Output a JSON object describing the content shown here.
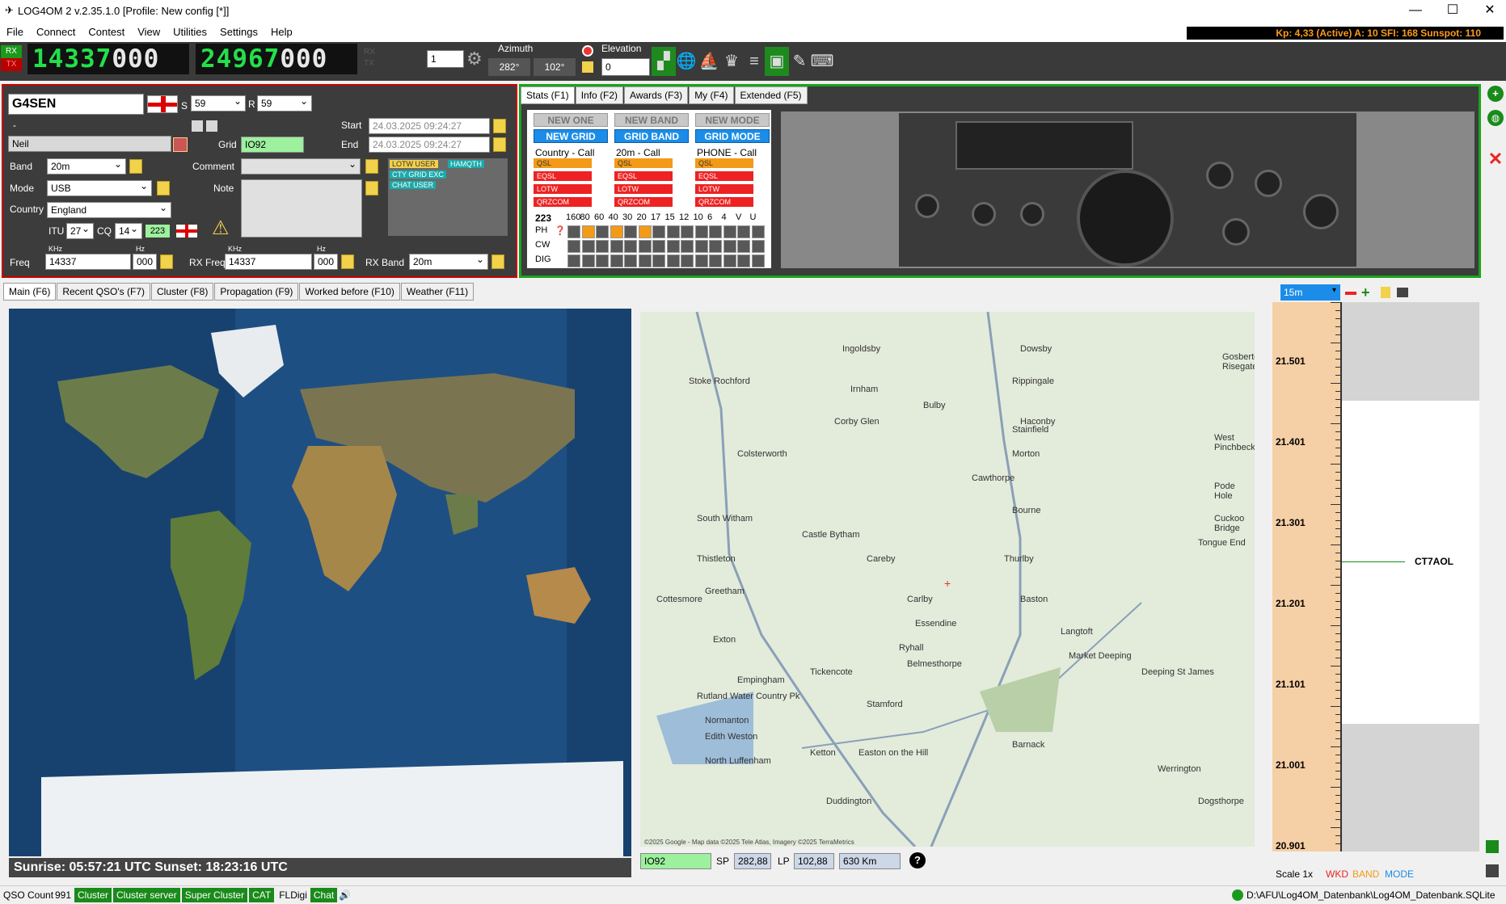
{
  "window": {
    "title": "LOG4OM 2 v.2.35.1.0 [Profile: New config [*]]"
  },
  "menu": [
    "File",
    "Connect",
    "Contest",
    "View",
    "Utilities",
    "Settings",
    "Help"
  ],
  "solar": {
    "text": "Kp: 4,33 (Active)  A: 10  SFI: 168 Sunspot: 110"
  },
  "toolbar": {
    "rx": "RX",
    "tx": "TX",
    "freq1_bright": "14337",
    "freq1_dim": "000",
    "freq2_bright": "24967",
    "freq2_dim": "000",
    "rx_small": "RX",
    "tx_small": "TX",
    "step": "1",
    "azimuth_label": "Azimuth",
    "azimuth_sp": "282°",
    "azimuth_lp": "102°",
    "elevation_label": "Elevation",
    "elevation_value": "0"
  },
  "qso": {
    "callsign": "G4SEN",
    "s_label": "S",
    "s_value": "59",
    "r_label": "R",
    "r_value": "59",
    "dash": "-",
    "name": "Neil",
    "grid_label": "Grid",
    "grid": "IO92",
    "start_label": "Start",
    "start": "24.03.2025 09:24:27",
    "end_label": "End",
    "end": "24.03.2025 09:24:27",
    "band_label": "Band",
    "band": "20m",
    "comment_label": "Comment",
    "mode_label": "Mode",
    "mode": "USB",
    "note_label": "Note",
    "country_label": "Country",
    "country": "England",
    "itu_label": "ITU",
    "itu": "27",
    "cq_label": "CQ",
    "cq": "14",
    "dxcc": "223",
    "freq_label": "Freq",
    "khz_label": "KHz",
    "hz_label": "Hz",
    "freq_khz": "14337",
    "freq_hz": "000",
    "rxfreq_label": "RX Freq",
    "rx_khz": "14337",
    "rx_hz": "000",
    "rxband_label": "RX Band",
    "rxband": "20m",
    "tags": [
      "LOTW USER",
      "HAMQTH",
      "CTY GRID EXC",
      "CHAT USER"
    ]
  },
  "stats": {
    "tabs": [
      "Stats (F1)",
      "Info (F2)",
      "Awards (F3)",
      "My (F4)",
      "Extended (F5)"
    ],
    "col1": {
      "top": "NEW ONE",
      "bottom": "NEW GRID",
      "header": "Country - Call"
    },
    "col2": {
      "top": "NEW BAND",
      "bottom": "GRID BAND",
      "header": "20m - Call"
    },
    "col3": {
      "top": "NEW MODE",
      "bottom": "GRID MODE",
      "header": "PHONE - Call"
    },
    "tags": [
      "QSL",
      "EQSL",
      "LOTW",
      "QRZCOM"
    ],
    "dxcc": "223",
    "bands": [
      "160",
      "80",
      "60",
      "40",
      "30",
      "20",
      "17",
      "15",
      "12",
      "10",
      "6",
      "4",
      "V",
      "U"
    ],
    "rows": [
      "PH",
      "CW",
      "DIG"
    ],
    "ph_marked": [
      1,
      3,
      5
    ]
  },
  "tabs2": [
    "Main (F6)",
    "Recent QSO's (F7)",
    "Cluster (F8)",
    "Propagation (F9)",
    "Worked before (F10)",
    "Weather (F11)"
  ],
  "sun": {
    "text": "Sunrise: 05:57:21 UTC   Sunset: 18:23:16 UTC"
  },
  "map": {
    "places": [
      "Ingoldsby",
      "Dowsby",
      "Gosberton Risegate",
      "Stoke Rochford",
      "Irnham",
      "Rippingale",
      "Bulby",
      "Corby Glen",
      "Haconby",
      "Stainfield",
      "West Pinchbeck",
      "Colsterworth",
      "Morton",
      "Cawthorpe",
      "Pode Hole",
      "Bourne",
      "Cuckoo Bridge",
      "South Witham",
      "Thistleton",
      "Castle Bytham",
      "Careby",
      "Tongue End",
      "Thurlby",
      "Greetham",
      "Carlby",
      "Baston",
      "Cottesmore",
      "Essendine",
      "Langtoft",
      "Exton",
      "Ryhall",
      "Belmesthorpe",
      "Market Deeping",
      "Deeping St James",
      "Empingham",
      "Tickencote",
      "Rutland Water Country Pk",
      "Stamford",
      "Normanton",
      "Edith Weston",
      "Barnack",
      "Ketton",
      "Easton on the Hill",
      "North Luffenham",
      "Werrington",
      "Duddington",
      "Dogsthorpe"
    ],
    "copyright": "©2025 Google - Map data ©2025 Tele Atlas, Imagery ©2025 TerraMetrics",
    "grid": "IO92",
    "sp_label": "SP",
    "sp": "282,88",
    "lp_label": "LP",
    "lp": "102,88",
    "distance": "630 Km",
    "help": "?"
  },
  "scope": {
    "band": "15m",
    "labels": [
      "21.501",
      "21.401",
      "21.301",
      "21.201",
      "21.101",
      "21.001",
      "20.901"
    ],
    "spot": "CT7AOL",
    "scale": "Scale 1x",
    "wkd": "WKD",
    "bandw": "BAND",
    "mode": "MODE"
  },
  "status": {
    "count_label": "QSO Count",
    "count": "991",
    "items": [
      "Cluster",
      "Cluster server",
      "Super Cluster",
      "CAT"
    ],
    "fldigi": "FLDigi",
    "chat": "Chat",
    "db": "D:\\AFU\\Log4OM_Datenbank\\Log4OM_Datenbank.SQLite"
  }
}
